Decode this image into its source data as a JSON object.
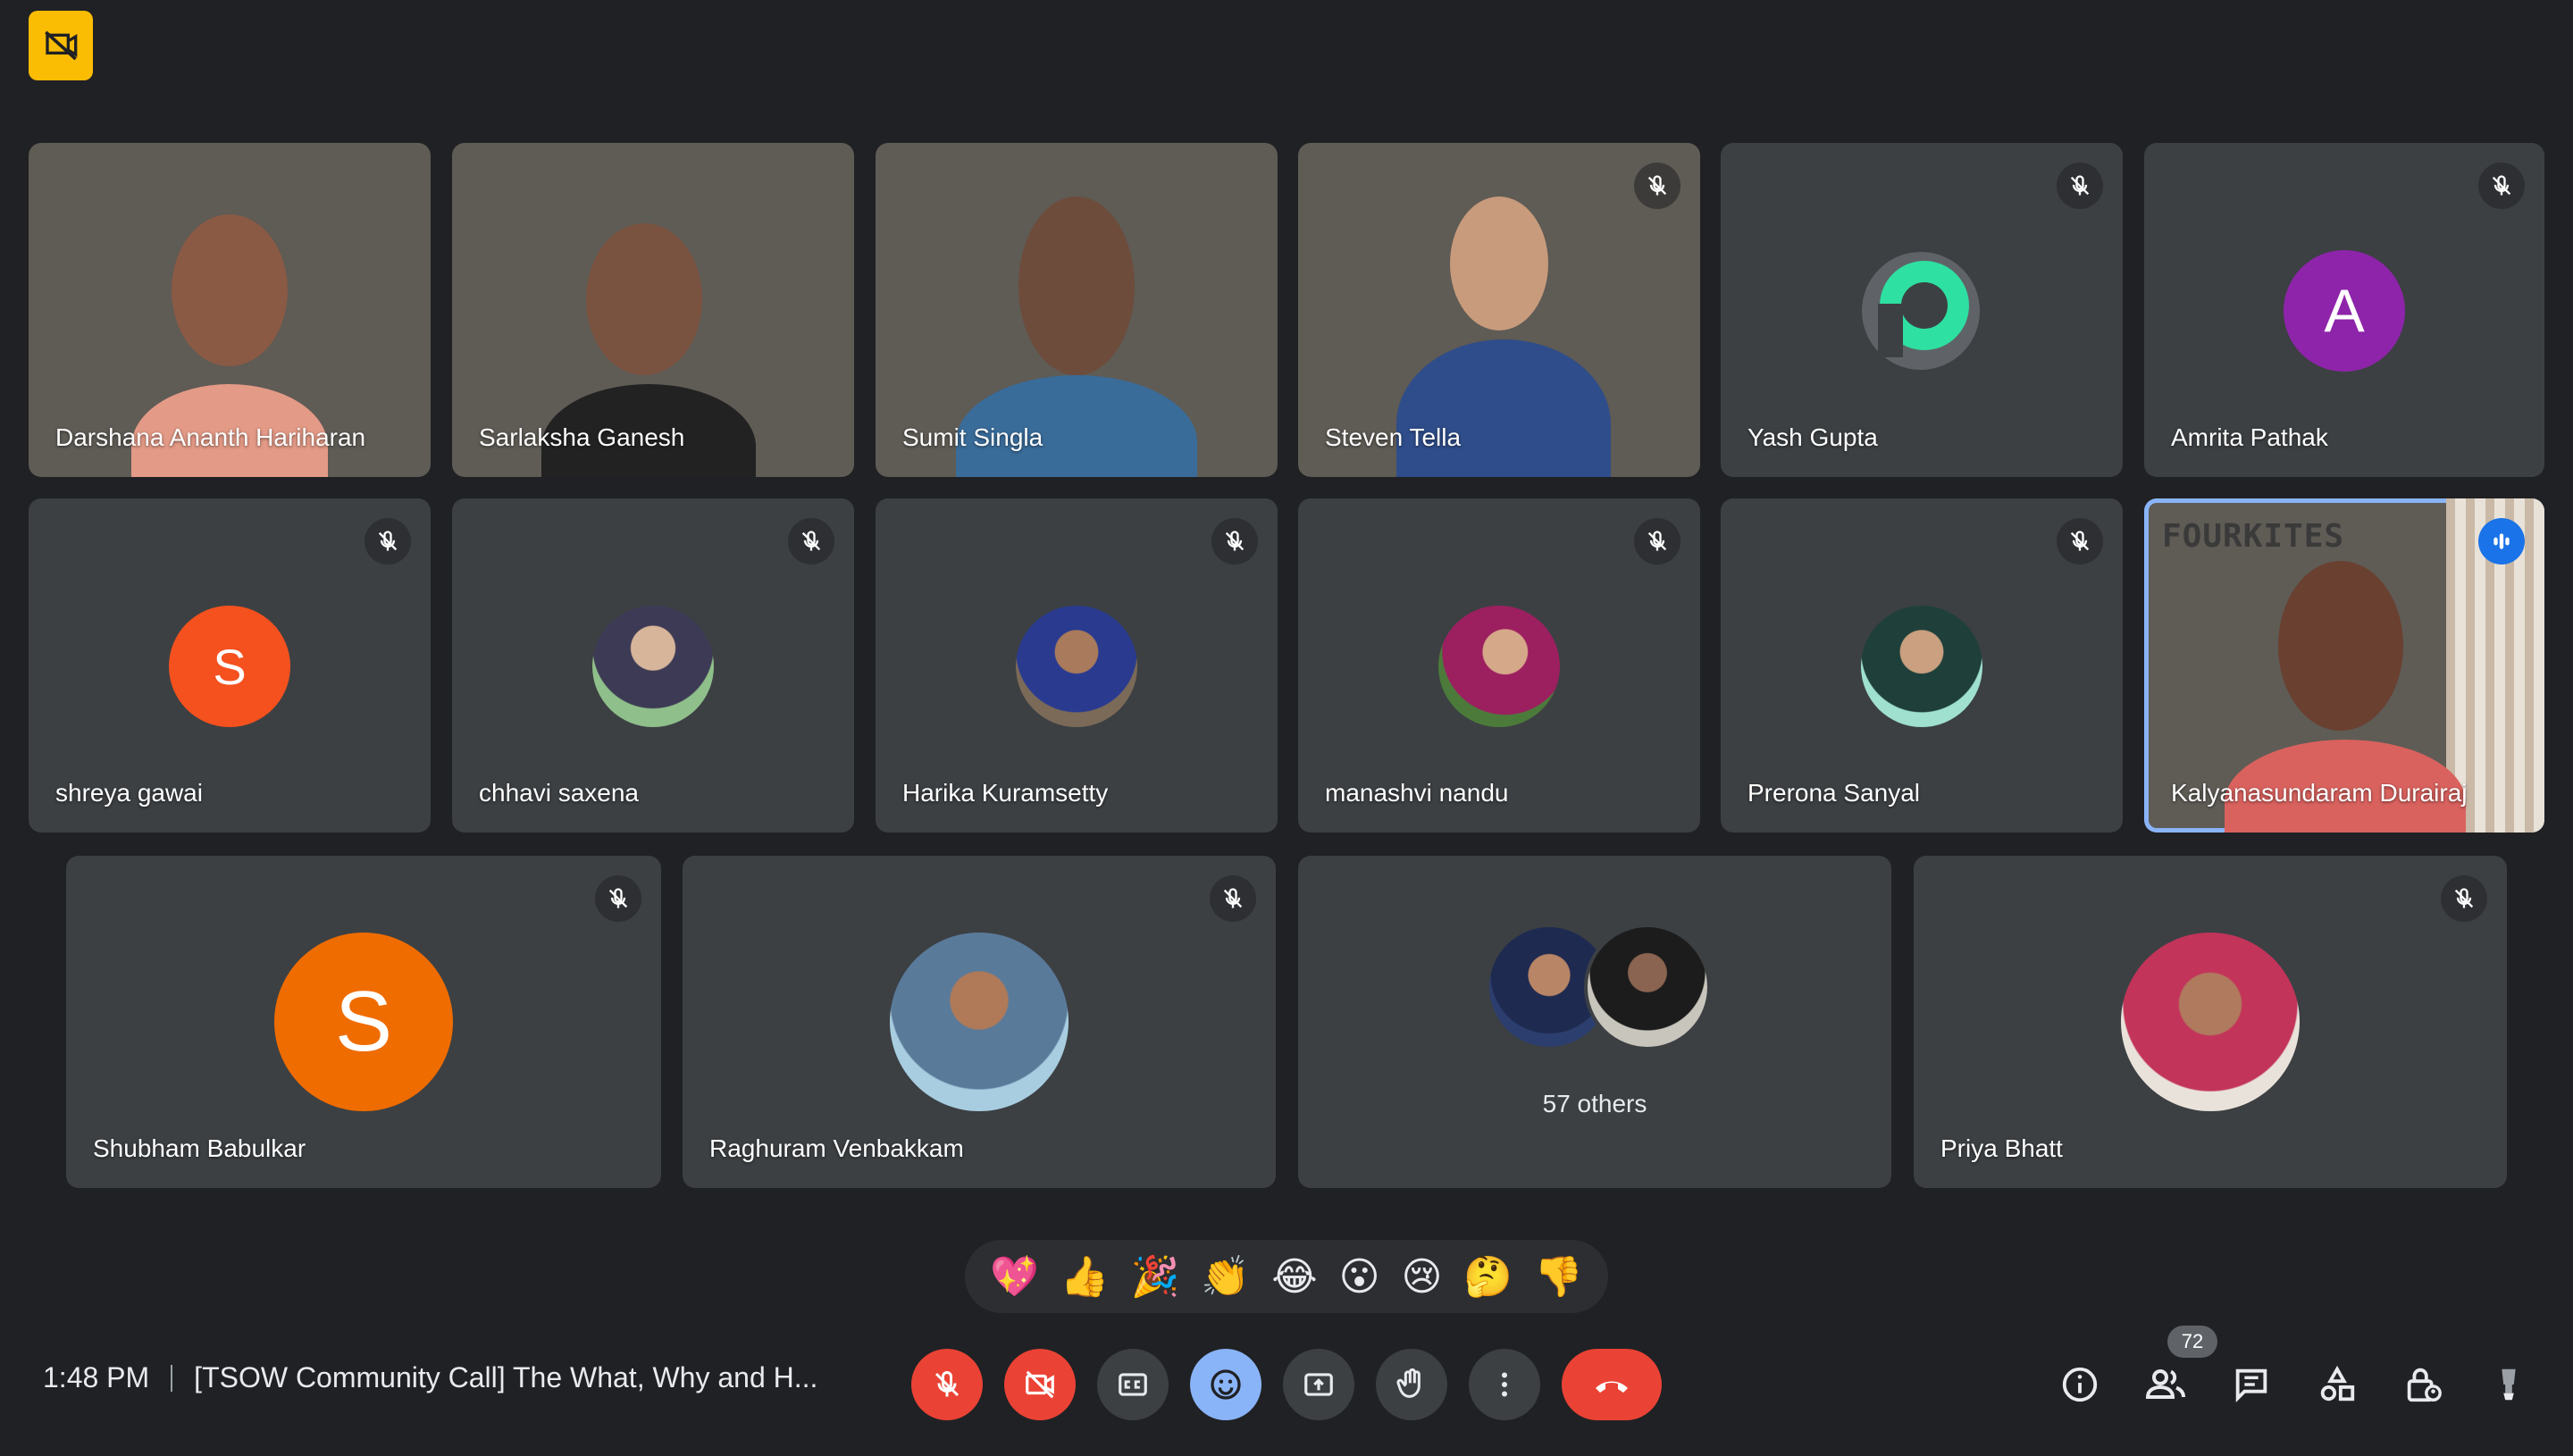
{
  "meeting": {
    "time": "1:48 PM",
    "title": "[TSOW Community Call] The What, Why and H...",
    "participant_count": "72"
  },
  "tiles": [
    {
      "name": "Darshana Ananth Hariharan"
    },
    {
      "name": "Sarlaksha Ganesh"
    },
    {
      "name": "Sumit Singla"
    },
    {
      "name": "Steven Tella"
    },
    {
      "name": "Yash Gupta"
    },
    {
      "name": "Amrita Pathak",
      "initial": "A"
    },
    {
      "name": "shreya gawai",
      "initial": "S"
    },
    {
      "name": "chhavi saxena"
    },
    {
      "name": "Harika Kuramsetty"
    },
    {
      "name": "manashvi nandu"
    },
    {
      "name": "Prerona Sanyal"
    },
    {
      "name": "Kalyanasundaram Durairaj",
      "overlay_text": "FOURKITES"
    },
    {
      "name": "Shubham Babulkar",
      "initial": "S"
    },
    {
      "name": "Raghuram Venbakkam"
    },
    {
      "name": "57 others"
    },
    {
      "name": "Priya Bhatt"
    }
  ],
  "reactions": [
    "💖",
    "👍",
    "🎉",
    "👏",
    "😂",
    "😮",
    "😢",
    "🤔",
    "👎"
  ],
  "colors": {
    "background": "#202124",
    "tile": "#3c4043",
    "accent_blue": "#8ab4f8",
    "danger_red": "#ea4335",
    "recording_yellow": "#fbbc04",
    "avatar_purple": "#8e24aa",
    "avatar_orange_red": "#f4511e",
    "avatar_orange": "#ef6c00"
  },
  "icons": {
    "top_left": "recording-off-icon",
    "controls": [
      "mic-off-icon",
      "camera-off-icon",
      "captions-icon",
      "emoji-icon",
      "present-icon",
      "raise-hand-icon",
      "more-options-icon",
      "hang-up-icon"
    ],
    "side": [
      "info-icon",
      "people-icon",
      "chat-icon",
      "activities-icon",
      "host-controls-icon",
      "companion-icon"
    ]
  }
}
